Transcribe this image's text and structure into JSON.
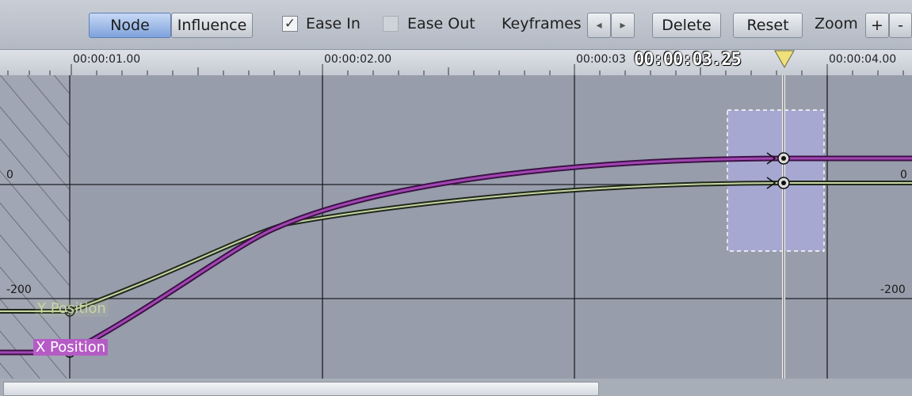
{
  "toolbar": {
    "node_label": "Node",
    "influence_label": "Influence",
    "ease_in_label": "Ease In",
    "ease_in_checked": true,
    "ease_out_label": "Ease Out",
    "ease_out_checked": false,
    "keyframes_label": "Keyframes",
    "prev_glyph": "◂",
    "next_glyph": "▸",
    "delete_label": "Delete",
    "reset_label": "Reset",
    "zoom_label": "Zoom",
    "zoom_in_glyph": "+",
    "zoom_out_glyph": "-"
  },
  "ruler": {
    "labels": [
      "00:00:01.00",
      "00:00:02.00",
      "00:00:03",
      "00:00:04.00"
    ],
    "current_time": "00:00:03.25",
    "playhead_icon": "triangle-down-icon"
  },
  "graph": {
    "axis_labels_left": [
      "0",
      "-200"
    ],
    "axis_labels_right": [
      "0",
      "-200"
    ],
    "curves": [
      {
        "name": "Y Position",
        "color": "#c9d4a4",
        "line_color": "#1e2a1a"
      },
      {
        "name": "X Position",
        "color": "#ffffff",
        "line_color": "#7a2a86"
      }
    ]
  },
  "colors": {
    "background": "#9aa0ad",
    "x_curve": "#7a2a86",
    "y_curve": "#8f9f6a",
    "selection": "#a8a9d2"
  }
}
